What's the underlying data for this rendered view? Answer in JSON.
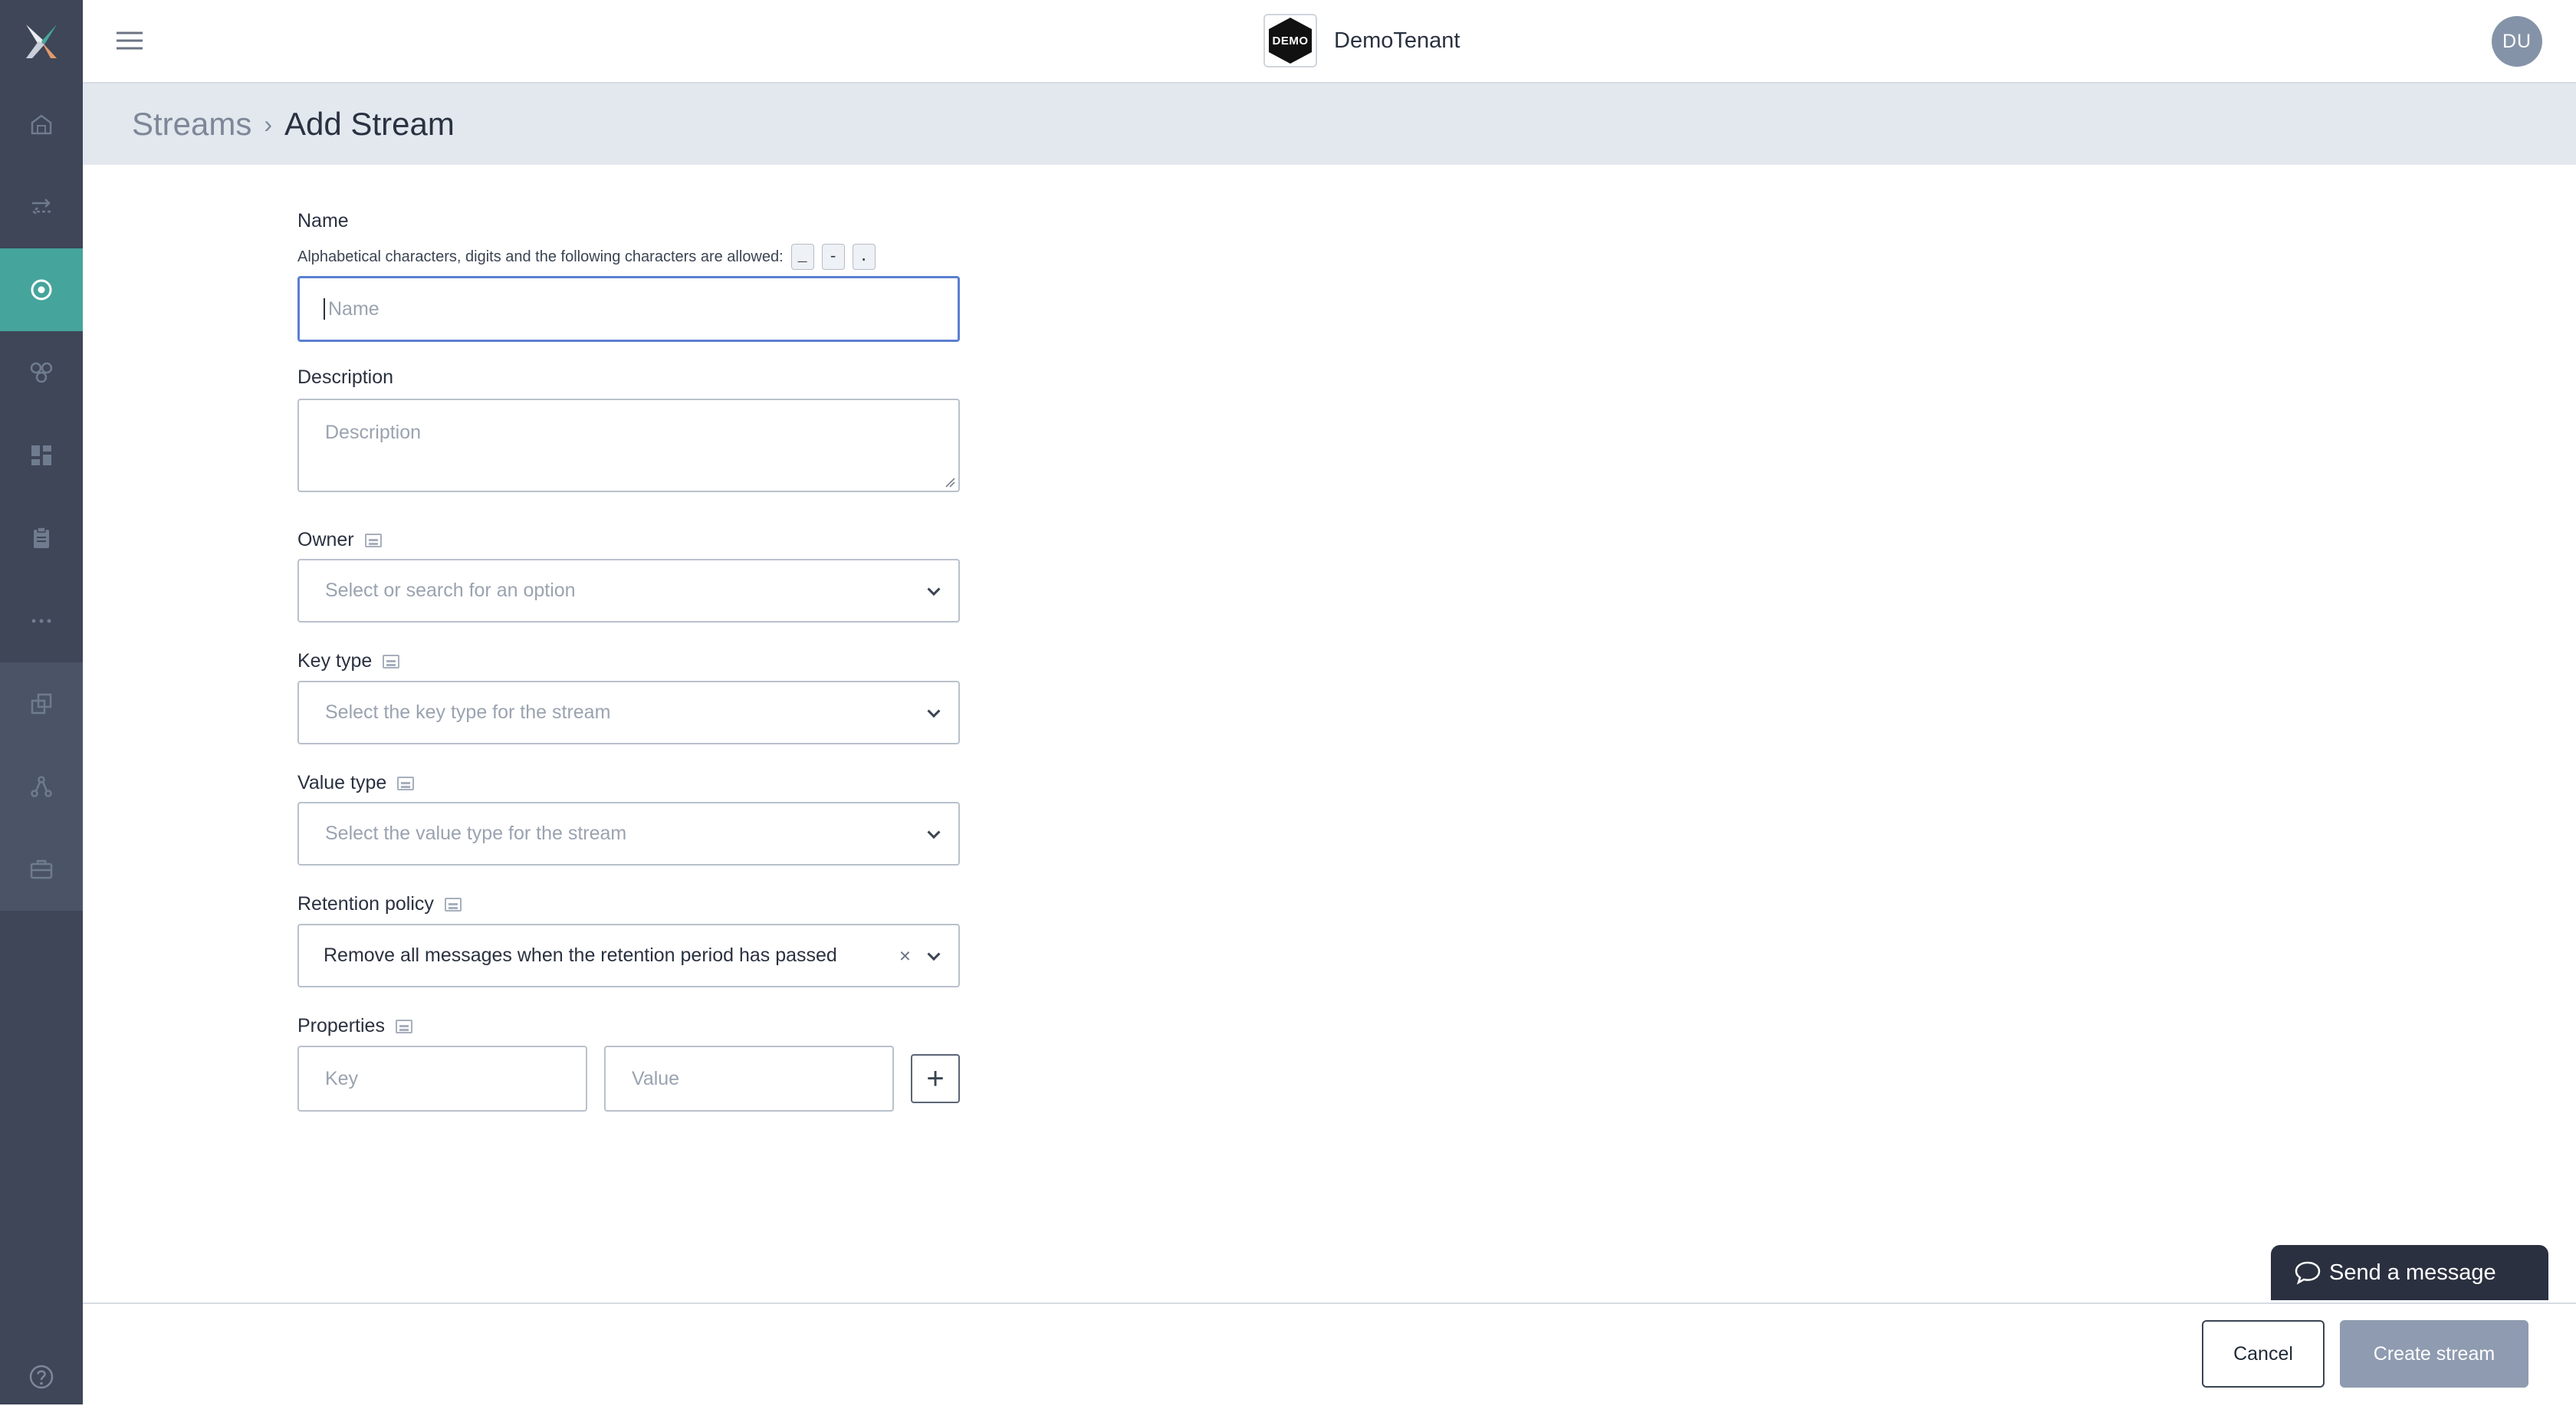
{
  "topbar": {
    "tenant_logo_text": "DEMO",
    "tenant_name": "DemoTenant",
    "avatar_initials": "DU"
  },
  "breadcrumb": {
    "parent": "Streams",
    "separator": "›",
    "current": "Add Stream"
  },
  "sidebar": {
    "items": [
      {
        "icon": "home-icon",
        "active": false
      },
      {
        "icon": "arrows-exchange-icon",
        "active": false
      },
      {
        "icon": "stream-target-icon",
        "active": true
      },
      {
        "icon": "cluster-icon",
        "active": false
      },
      {
        "icon": "dashboard-grid-icon",
        "active": false
      },
      {
        "icon": "clipboard-icon",
        "active": false
      },
      {
        "icon": "more-dots-icon",
        "active": false
      },
      {
        "icon": "copy-icon",
        "active": false
      },
      {
        "icon": "network-icon",
        "active": false
      },
      {
        "icon": "briefcase-icon",
        "active": false
      }
    ],
    "help_icon": "help-icon"
  },
  "form": {
    "name": {
      "label": "Name",
      "hint": "Alphabetical characters, digits and the following characters are allowed:",
      "allowed_chars": [
        "_",
        "-",
        "."
      ],
      "placeholder": "Name",
      "value": ""
    },
    "description": {
      "label": "Description",
      "placeholder": "Description",
      "value": ""
    },
    "owner": {
      "label": "Owner",
      "placeholder": "Select or search for an option"
    },
    "key_type": {
      "label": "Key type",
      "placeholder": "Select the key type for the stream"
    },
    "value_type": {
      "label": "Value type",
      "placeholder": "Select the value type for the stream"
    },
    "retention_policy": {
      "label": "Retention policy",
      "selected": "Remove all messages when the retention period has passed",
      "clear_glyph": "×"
    },
    "properties": {
      "label": "Properties",
      "key_placeholder": "Key",
      "value_placeholder": "Value",
      "add_glyph": "+"
    }
  },
  "footer": {
    "cancel_label": "Cancel",
    "create_label": "Create stream"
  },
  "chat_widget": {
    "label": "Send a message"
  },
  "colors": {
    "sidebar_bg": "#3e4657",
    "sidebar_active": "#45a49b",
    "breadcrumb_bg": "#e3e8ef",
    "focus_border": "#5b7fd1",
    "primary_disabled": "#8e9bb0"
  }
}
